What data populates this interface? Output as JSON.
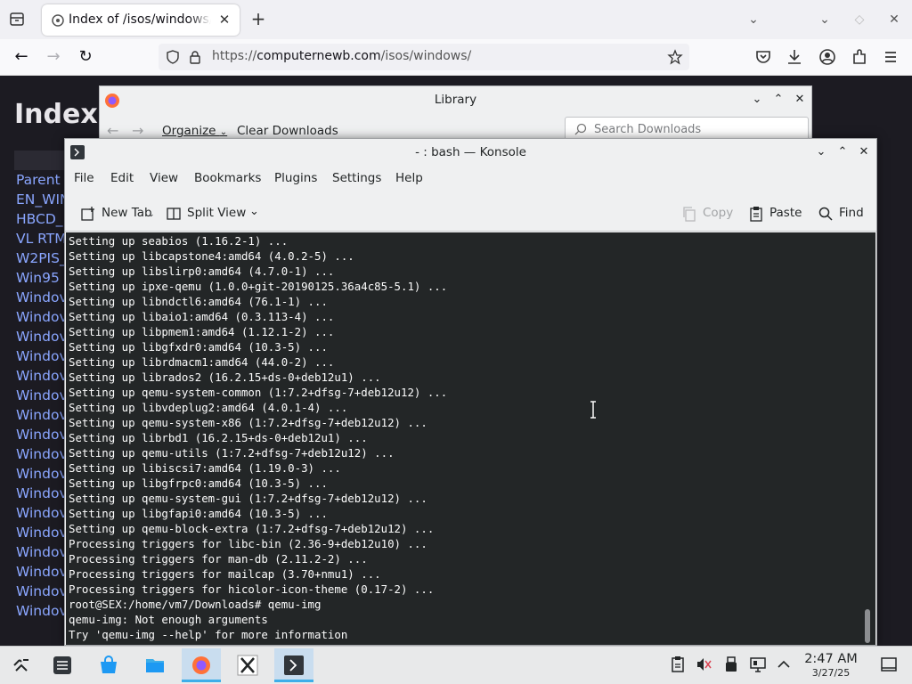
{
  "browser": {
    "tab_title": "Index of /isos/windows/",
    "url_prefix": "https://",
    "url_domain": "computernewb.com",
    "url_path": "/isos/windows/",
    "page_heading": "Index o",
    "listing": [
      "Parent d",
      "EN_WIN",
      "HBCD_",
      "VL RTM",
      "W2PIS_",
      "Win95 ",
      "Windov",
      "Windov",
      "Windov",
      "Windov",
      "Windov",
      "Windov",
      "Windov",
      "Windov",
      "Windov",
      "Windov",
      "Windov",
      "Windov",
      "Windov",
      "Windov",
      "Windov",
      "Windov",
      "Windov"
    ]
  },
  "library": {
    "title": "Library",
    "organize": "Organize",
    "clear": "Clear Downloads",
    "search_placeholder": "Search Downloads"
  },
  "konsole": {
    "title": "- : bash — Konsole",
    "menu": [
      "File",
      "Edit",
      "View",
      "Bookmarks",
      "Plugins",
      "Settings",
      "Help"
    ],
    "toolbar": {
      "new_tab": "New Tab",
      "split_view": "Split View",
      "copy": "Copy",
      "paste": "Paste",
      "find": "Find"
    },
    "lines": [
      "Setting up seabios (1.16.2-1) ...",
      "Setting up libcapstone4:amd64 (4.0.2-5) ...",
      "Setting up libslirp0:amd64 (4.7.0-1) ...",
      "Setting up ipxe-qemu (1.0.0+git-20190125.36a4c85-5.1) ...",
      "Setting up libndctl6:amd64 (76.1-1) ...",
      "Setting up libaio1:amd64 (0.3.113-4) ...",
      "Setting up libpmem1:amd64 (1.12.1-2) ...",
      "Setting up libgfxdr0:amd64 (10.3-5) ...",
      "Setting up librdmacm1:amd64 (44.0-2) ...",
      "Setting up librados2 (16.2.15+ds-0+deb12u1) ...",
      "Setting up qemu-system-common (1:7.2+dfsg-7+deb12u12) ...",
      "Setting up libvdeplug2:amd64 (4.0.1-4) ...",
      "Setting up qemu-system-x86 (1:7.2+dfsg-7+deb12u12) ...",
      "Setting up librbd1 (16.2.15+ds-0+deb12u1) ...",
      "Setting up qemu-utils (1:7.2+dfsg-7+deb12u12) ...",
      "Setting up libiscsi7:amd64 (1.19.0-3) ...",
      "Setting up libgfrpc0:amd64 (10.3-5) ...",
      "Setting up qemu-system-gui (1:7.2+dfsg-7+deb12u12) ...",
      "Setting up libgfapi0:amd64 (10.3-5) ...",
      "Setting up qemu-block-extra (1:7.2+dfsg-7+deb12u12) ...",
      "Processing triggers for libc-bin (2.36-9+deb12u10) ...",
      "Processing triggers for man-db (2.11.2-2) ...",
      "Processing triggers for mailcap (3.70+nmu1) ...",
      "Processing triggers for hicolor-icon-theme (0.17-2) ...",
      "root@SEX:/home/vm7/Downloads# qemu-img",
      "qemu-img: Not enough arguments",
      "Try 'qemu-img --help' for more information"
    ]
  },
  "taskbar": {
    "time": "2:47 AM",
    "date": "3/27/25"
  },
  "colors": {
    "accent": "#3daee9",
    "terminal_bg": "#232627",
    "terminal_fg": "#fcfcfc",
    "link": "#8aa6ff"
  }
}
